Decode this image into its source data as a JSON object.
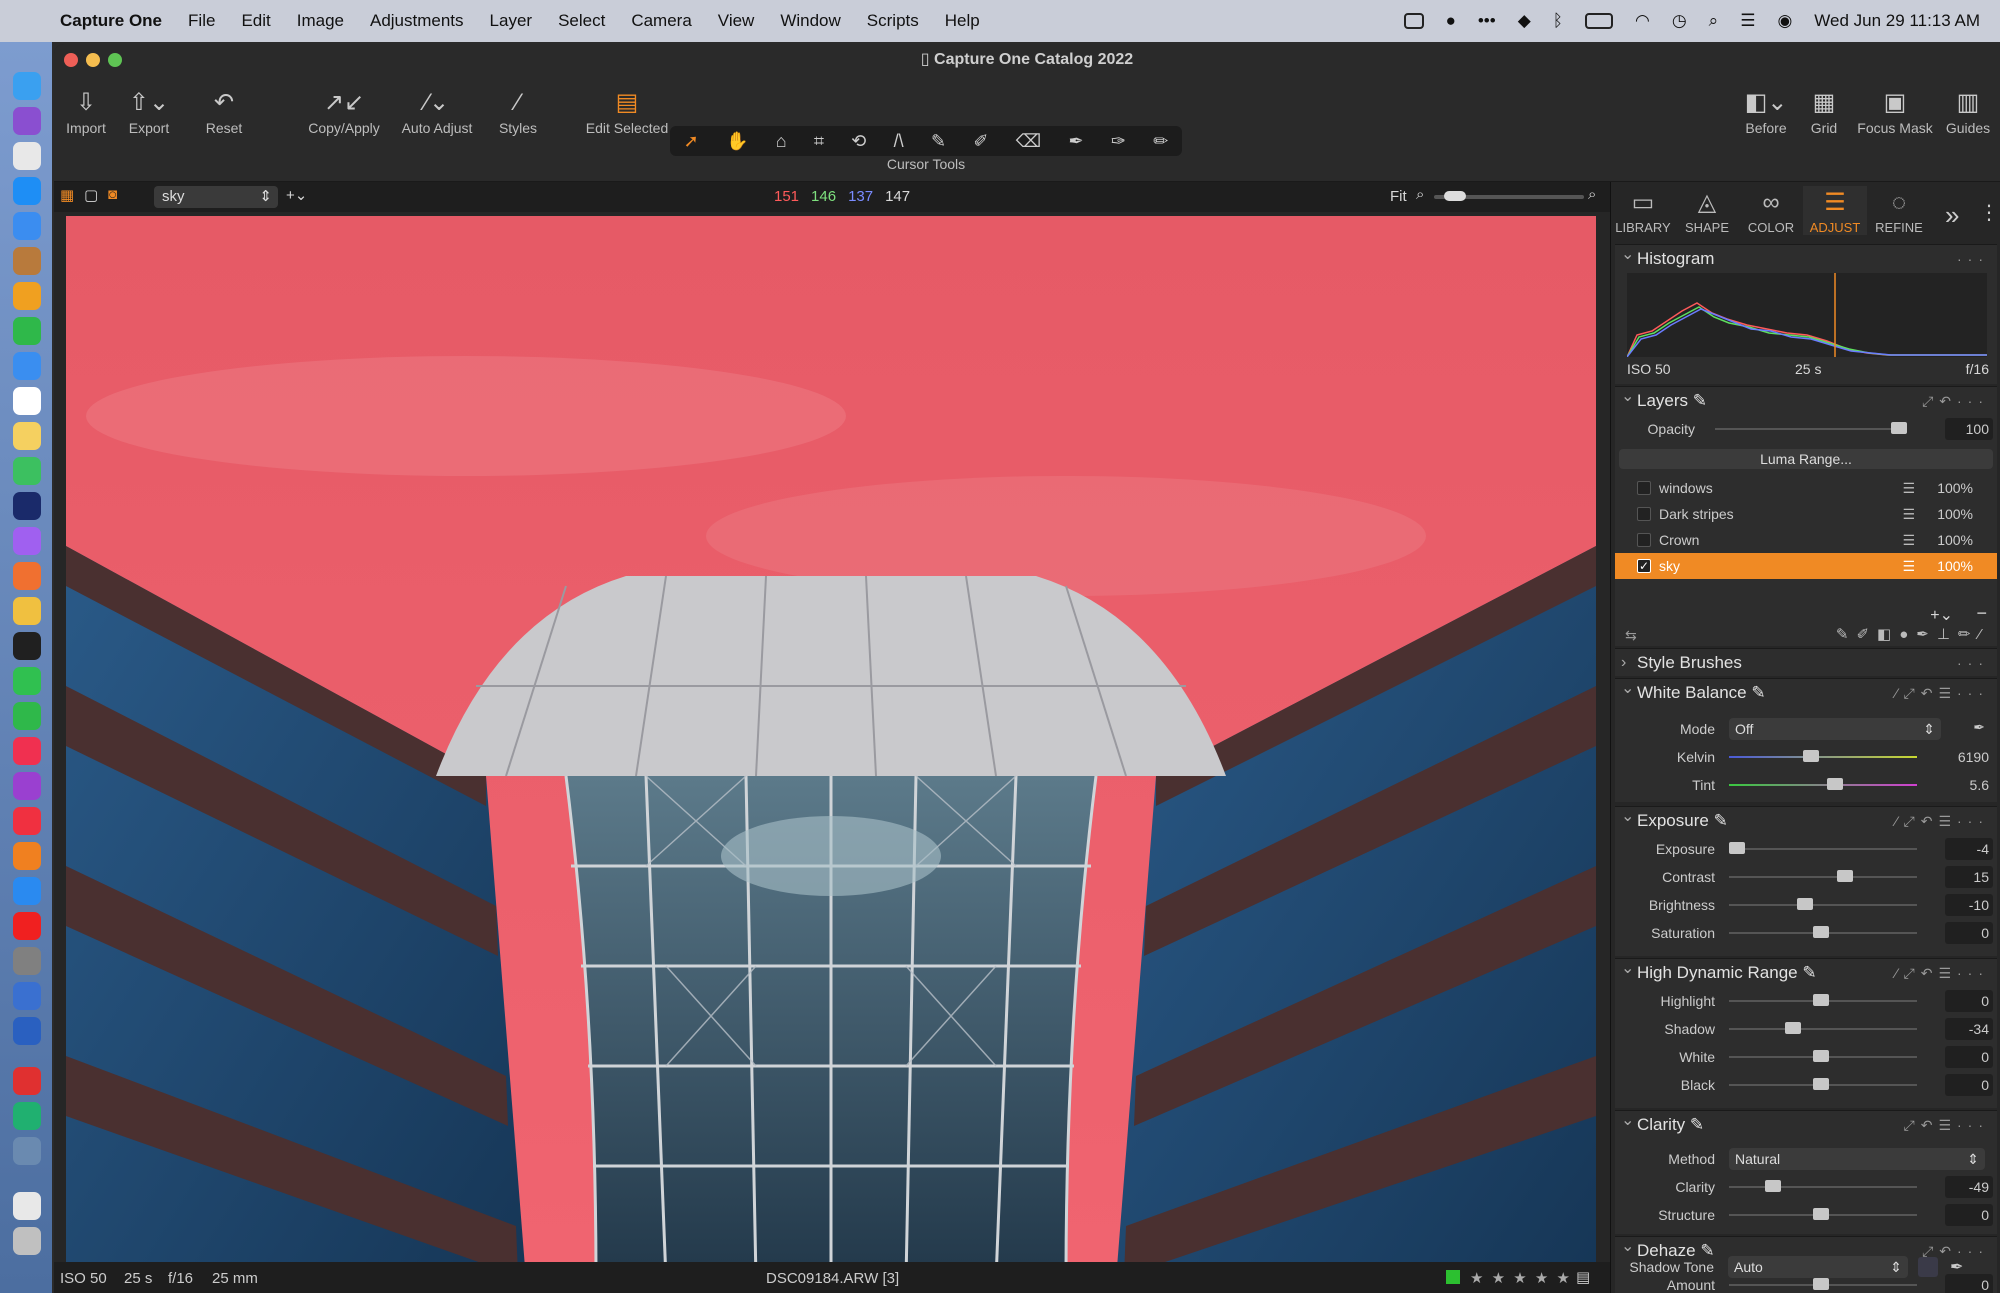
{
  "menubar": {
    "app": "Capture One",
    "items": [
      "File",
      "Edit",
      "Image",
      "Adjustments",
      "Layer",
      "Select",
      "Camera",
      "View",
      "Window",
      "Scripts",
      "Help"
    ],
    "datetime": "Wed Jun 29  11:13 AM"
  },
  "window": {
    "title": "Capture One Catalog 2022"
  },
  "toolbar": {
    "import": "Import",
    "export": "Export",
    "reset": "Reset",
    "copy_apply": "Copy/Apply",
    "auto_adjust": "Auto Adjust",
    "styles": "Styles",
    "edit_selected": "Edit Selected",
    "cursor_tools": "Cursor Tools",
    "before": "Before",
    "grid": "Grid",
    "focus_mask": "Focus Mask",
    "guides": "Guides"
  },
  "viewbar": {
    "layer_select": "sky",
    "r": "151",
    "g": "146",
    "b": "137",
    "l": "147",
    "fit": "Fit",
    "colors": {
      "r": "#ff5a5a",
      "g": "#7ee07e",
      "b": "#7a8cff"
    }
  },
  "status": {
    "iso": "ISO 50",
    "shutter": "25 s",
    "aperture": "f/16",
    "focal": "25 mm",
    "filename": "DSC09184.ARW [3]",
    "stars": "★ ★ ★ ★ ★"
  },
  "panel": {
    "tabs": [
      {
        "label": "LIBRARY",
        "icon": "folder-icon"
      },
      {
        "label": "SHAPE",
        "icon": "shape-icon"
      },
      {
        "label": "COLOR",
        "icon": "color-icon"
      },
      {
        "label": "ADJUST",
        "icon": "adjust-icon"
      },
      {
        "label": "REFINE",
        "icon": "refine-icon"
      }
    ],
    "histogram": {
      "title": "Histogram",
      "iso": "ISO 50",
      "shutter": "25 s",
      "aperture": "f/16"
    },
    "layers": {
      "title": "Layers",
      "opacity_label": "Opacity",
      "opacity_value": "100",
      "opacity": 1.0,
      "luma_range": "Luma Range...",
      "items": [
        {
          "name": "windows",
          "pct": "100%"
        },
        {
          "name": "Dark stripes",
          "pct": "100%"
        },
        {
          "name": "Crown",
          "pct": "100%"
        },
        {
          "name": "sky",
          "pct": "100%",
          "selected": true
        }
      ]
    },
    "style_brushes": {
      "title": "Style Brushes"
    },
    "white_balance": {
      "title": "White Balance",
      "mode_label": "Mode",
      "mode_value": "Off",
      "kelvin_label": "Kelvin",
      "kelvin_value": "6190",
      "tint_label": "Tint",
      "tint_value": "5.6"
    },
    "exposure": {
      "title": "Exposure",
      "rows": [
        {
          "label": "Exposure",
          "value": "-4"
        },
        {
          "label": "Contrast",
          "value": "15"
        },
        {
          "label": "Brightness",
          "value": "-10"
        },
        {
          "label": "Saturation",
          "value": "0"
        }
      ]
    },
    "hdr": {
      "title": "High Dynamic Range",
      "rows": [
        {
          "label": "Highlight",
          "value": "0"
        },
        {
          "label": "Shadow",
          "value": "-34"
        },
        {
          "label": "White",
          "value": "0"
        },
        {
          "label": "Black",
          "value": "0"
        }
      ]
    },
    "clarity": {
      "title": "Clarity",
      "method_label": "Method",
      "method_value": "Natural",
      "rows": [
        {
          "label": "Clarity",
          "value": "-49"
        },
        {
          "label": "Structure",
          "value": "0"
        }
      ]
    },
    "dehaze": {
      "title": "Dehaze",
      "amount_label": "Amount",
      "amount_value": "0",
      "shadow_label": "Shadow Tone",
      "shadow_value": "Auto"
    }
  },
  "accent": "#f08a24"
}
